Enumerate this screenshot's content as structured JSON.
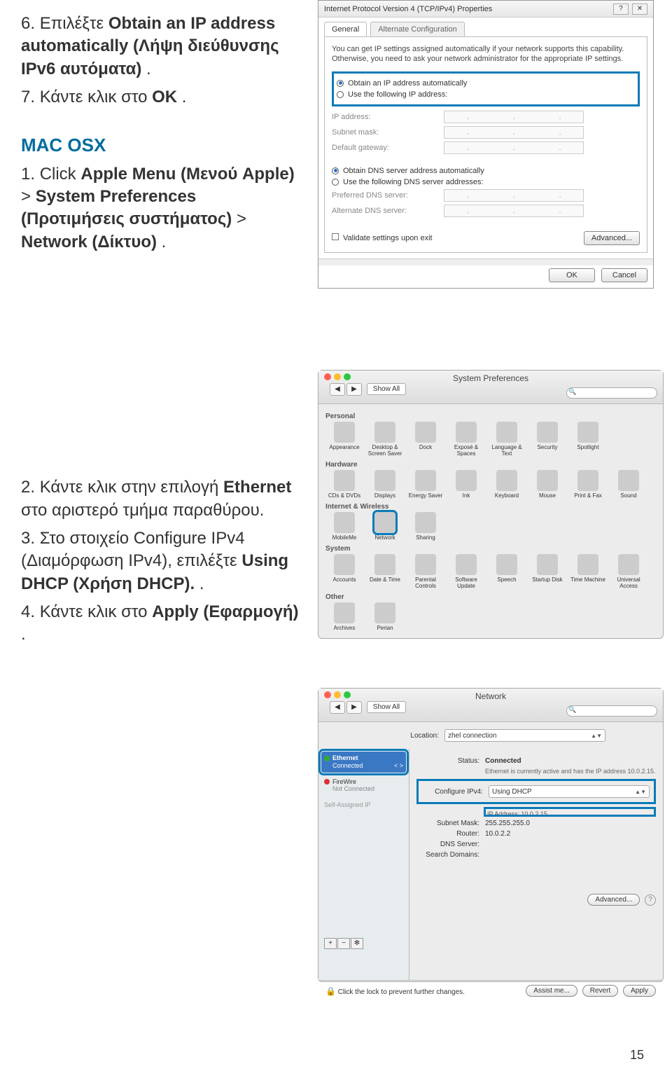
{
  "steps": {
    "s6_pre": "Επιλέξτε ",
    "s6_bold": "Obtain an IP address automatically (Λήψη διεύθυνσης IPv6 αυτόματα)",
    "s6_post": ".",
    "s7_pre": "Κάντε κλικ στο ",
    "s7_bold": "OK",
    "s7_post": "."
  },
  "mac_heading": "MAC OSX",
  "mac_steps": {
    "m1_pre": "Click ",
    "m1_bold1": "Apple Menu (Μενού Apple)",
    "m1_mid": ">",
    "m1_bold2": "System Preferences (Προτιμήσεις συστήματος)",
    "m1_mid2": " > ",
    "m1_bold3": "Network (Δίκτυο)",
    "m1_post": ".",
    "m2_pre": "Κάντε κλικ στην επιλογή ",
    "m2_bold": "Ethernet",
    "m2_post": " στο αριστερό τμήμα παραθύρου.",
    "m3_pre": "Στο στοιχείο Configure IPv4 (Διαμόρφωση IPv4), επιλέξτε ",
    "m3_bold": "Using DHCP (Χρήση DHCP).",
    "m3_post": ".",
    "m4_pre": "Κάντε κλικ στο ",
    "m4_bold": "Apply (Εφαρμογή)",
    "m4_post": "."
  },
  "win": {
    "title": "Internet Protocol Version 4 (TCP/IPv4) Properties",
    "help": "?",
    "close": "✕",
    "tab1": "General",
    "tab2": "Alternate Configuration",
    "intro": "You can get IP settings assigned automatically if your network supports this capability. Otherwise, you need to ask your network administrator for the appropriate IP settings.",
    "opt1": "Obtain an IP address automatically",
    "opt2": "Use the following IP address:",
    "ip_label": "IP address:",
    "subnet_label": "Subnet mask:",
    "gw_label": "Default gateway:",
    "dns1": "Obtain DNS server address automatically",
    "dns2": "Use the following DNS server addresses:",
    "pdns": "Preferred DNS server:",
    "adns": "Alternate DNS server:",
    "validate": "Validate settings upon exit",
    "advanced": "Advanced...",
    "ok": "OK",
    "cancel": "Cancel"
  },
  "prefs": {
    "title": "System Preferences",
    "showall": "Show All",
    "cat_personal": "Personal",
    "cat_hardware": "Hardware",
    "cat_internet": "Internet & Wireless",
    "cat_system": "System",
    "cat_other": "Other",
    "items_personal": [
      "Appearance",
      "Desktop & Screen Saver",
      "Dock",
      "Exposé & Spaces",
      "Language & Text",
      "Security",
      "Spotlight"
    ],
    "items_hardware": [
      "CDs & DVDs",
      "Displays",
      "Energy Saver",
      "Ink",
      "Keyboard",
      "Mouse",
      "Print & Fax",
      "Sound"
    ],
    "items_internet": [
      "MobileMe",
      "Network",
      "Sharing"
    ],
    "items_system": [
      "Accounts",
      "Date & Time",
      "Parental Controls",
      "Software Update",
      "Speech",
      "Startup Disk",
      "Time Machine",
      "Universal Access"
    ],
    "items_other": [
      "Archives",
      "Perian"
    ]
  },
  "net": {
    "title": "Network",
    "showall": "Show All",
    "loc_label": "Location:",
    "loc_val": "zhel connection",
    "side_eth": "Ethernet",
    "side_eth_sub": "Connected",
    "side_fw": "FireWire",
    "side_fw_sub": "Not Connected",
    "side_sip": "Self-Assigned IP",
    "configure": "< >",
    "status_label": "Status:",
    "status_val": "Connected",
    "status_sub": "Ethernet is currently active and has the IP address 10.0.2.15.",
    "cfg_label": "Configure IPv4:",
    "cfg_val": "Using DHCP",
    "ipaddr_label": "IP Address:",
    "ipaddr_val": "10.0.2.15",
    "subnet_label": "Subnet Mask:",
    "subnet_val": "255.255.255.0",
    "router_label": "Router:",
    "router_val": "10.0.2.2",
    "dns_label": "DNS Server:",
    "search_label": "Search Domains:",
    "advanced": "Advanced...",
    "lock_txt": "Click the lock to prevent further changes.",
    "assist": "Assist me...",
    "revert": "Revert",
    "apply": "Apply"
  },
  "pagenum": "15"
}
